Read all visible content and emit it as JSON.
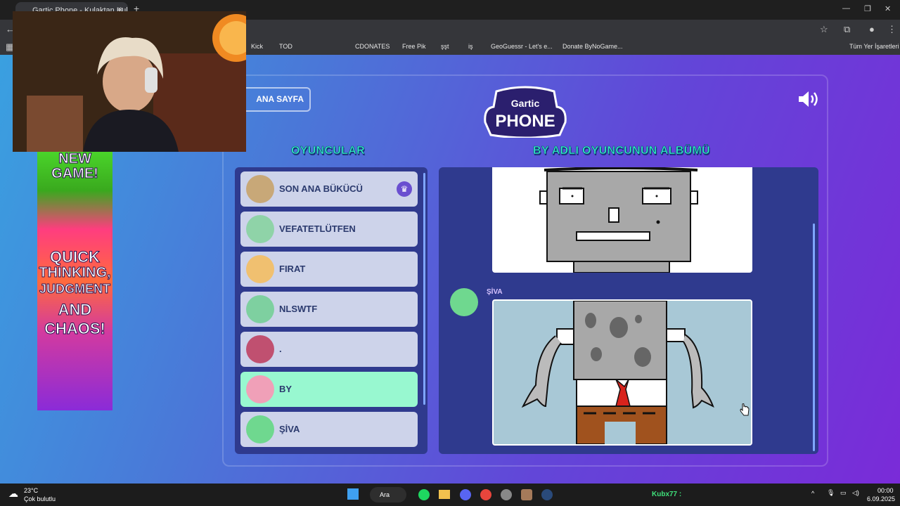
{
  "browser": {
    "tab_title": "Gartic Phone - Kulaktan Kulağa",
    "tab_close": "✕",
    "new_tab": "+",
    "bookmarks": [
      "Kick",
      "TOD",
      "CDONATES",
      "Free Pik",
      "şşt",
      "iş",
      "GeoGuessr - Let's e...",
      "Donate ByNoGame...",
      "Tüm Yer İşaretleri"
    ]
  },
  "game": {
    "home_label": "ANA SAYFA",
    "logo_top": "Gartic",
    "logo_bottom": "PHONE",
    "players_heading": "OYUNCULAR",
    "album_heading": "BY ADLI OYUNCUNUN ALBÜMÜ",
    "players": [
      {
        "name": "SON ANA BÜKÜCÜ",
        "host": true,
        "active": false,
        "avatar_color": "#c8a878"
      },
      {
        "name": "VEFATETLÜTFEN",
        "host": false,
        "active": false,
        "avatar_color": "#8fd3a8"
      },
      {
        "name": "FIRAT",
        "host": false,
        "active": false,
        "avatar_color": "#f0c070"
      },
      {
        "name": "NLSWTF",
        "host": false,
        "active": false,
        "avatar_color": "#7ed0a0"
      },
      {
        "name": ".",
        "host": false,
        "active": false,
        "avatar_color": "#c05070"
      },
      {
        "name": "BY",
        "host": false,
        "active": true,
        "avatar_color": "#f0a0b8"
      },
      {
        "name": "ŞİVA",
        "host": false,
        "active": false,
        "avatar_color": "#6fd88f"
      }
    ],
    "album_author": "ŞİVA"
  },
  "ad": {
    "line1": "NEW",
    "line2": "GAME!",
    "line3": "QUICK",
    "line4": "THINKING,",
    "line5": "JUDGMENT",
    "line6": "AND",
    "line7": "CHAOS!"
  },
  "taskbar": {
    "weather_temp": "23°C",
    "weather_desc": "Çok bulutlu",
    "search_label": "Ara",
    "overlay_label": "Kubx77 :",
    "time": "00:00",
    "date": "6.09.2025"
  }
}
